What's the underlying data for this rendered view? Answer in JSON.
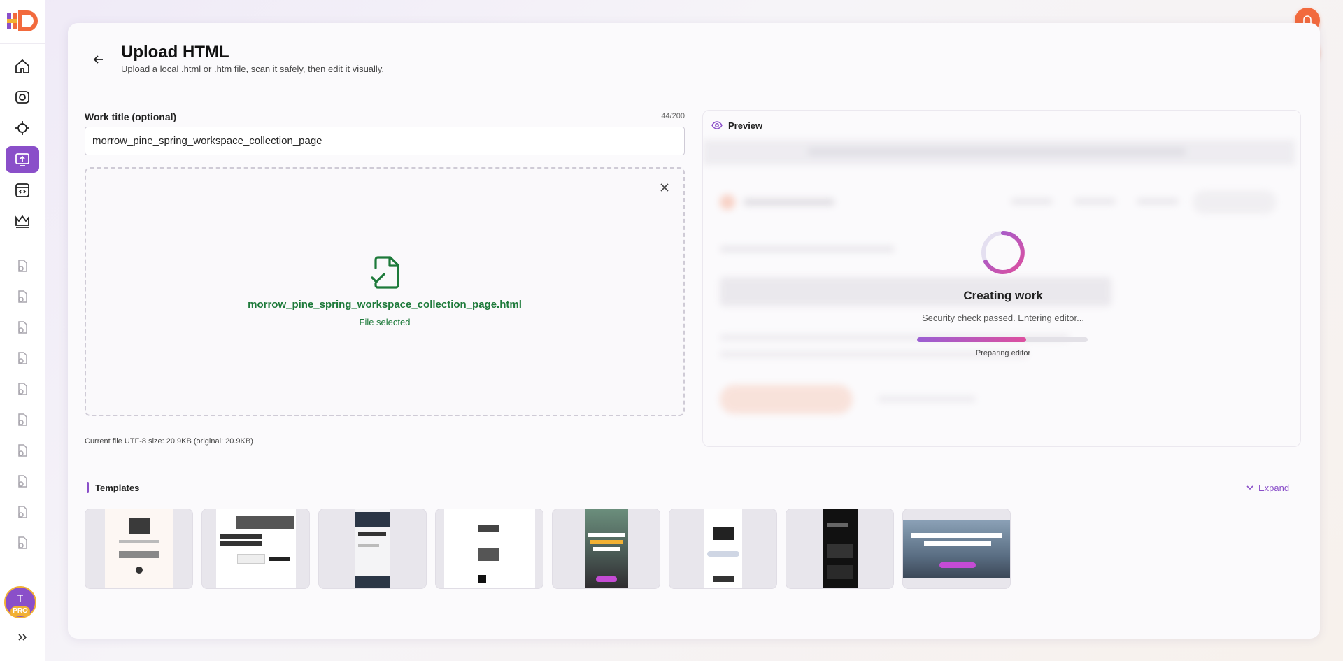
{
  "header": {
    "title": "Upload HTML",
    "subtitle": "Upload a local .html or .htm file, scan it safely, then edit it visually."
  },
  "form": {
    "title_label": "Work title (optional)",
    "char_count": "44/200",
    "title_value": "morrow_pine_spring_workspace_collection_page"
  },
  "dropzone": {
    "file_name": "morrow_pine_spring_workspace_collection_page.html",
    "status": "File selected"
  },
  "file_size_text": "Current file UTF-8 size: 20.9KB (original: 20.9KB)",
  "preview": {
    "label": "Preview",
    "loading_title": "Creating work",
    "loading_subtitle": "Security check passed. Entering editor...",
    "progress_label": "Preparing editor",
    "progress_fraction": 0.64
  },
  "templates": {
    "title": "Templates",
    "expand_label": "Expand",
    "count": 8
  },
  "user": {
    "avatar_initial": "T",
    "badge": "PRO"
  },
  "colors": {
    "accent": "#8a4fc9",
    "success": "#1d7a3a",
    "fab": "#f26a3d"
  },
  "icons": {
    "nav": [
      "home-icon",
      "camera-icon",
      "crosshair-icon",
      "upload-html-icon",
      "code-file-icon",
      "crown-icon"
    ],
    "history": "history-page-icon",
    "fabs": [
      "bell-icon",
      "wrench-icon"
    ]
  }
}
